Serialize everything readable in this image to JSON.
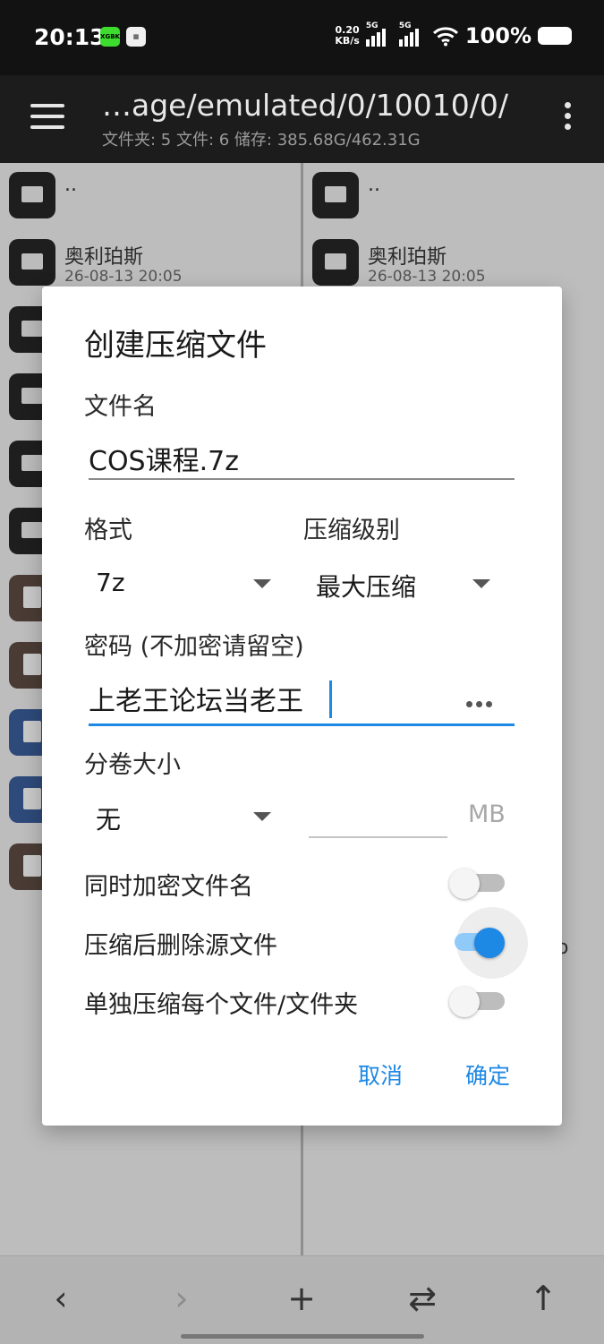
{
  "status_bar": {
    "time": "20:13",
    "net_speed_value": "0.20",
    "net_speed_unit": "KB/s",
    "sim1_label": "5G",
    "sim2_label": "5G",
    "battery_pct": "100%",
    "badge1": "XGBK",
    "badge1_color": "#3ddc2e"
  },
  "app_bar": {
    "path": "…age/emulated/0/10010/0/",
    "summary": "文件夹: 5   文件: 6   储存: 385.68G/462.31G"
  },
  "panes": {
    "left": [
      {
        "name": "..",
        "date": "",
        "kind": "folder"
      },
      {
        "name": "奥利珀斯",
        "date": "26-08-13 20:05",
        "kind": "folder"
      },
      {
        "name": "",
        "date": "",
        "kind": "folder"
      },
      {
        "name": "",
        "date": "",
        "kind": "folder"
      },
      {
        "name": "",
        "date": "",
        "kind": "folder"
      },
      {
        "name": "",
        "date": "",
        "kind": "folder"
      },
      {
        "name": "",
        "date": "",
        "kind": "archive"
      },
      {
        "name": "",
        "date": "",
        "kind": "archive"
      },
      {
        "name": "",
        "date": "",
        "kind": "doc"
      },
      {
        "name": "",
        "date": "",
        "kind": "doc"
      },
      {
        "name": "",
        "date": "",
        "kind": "archive"
      }
    ],
    "right": [
      {
        "name": "..",
        "date": "",
        "kind": "folder"
      },
      {
        "name": "奥利珀斯",
        "date": "26-08-13 20:05",
        "kind": "folder"
      }
    ],
    "right_stray_text": "o"
  },
  "dialog": {
    "title": "创建压缩文件",
    "filename_label": "文件名",
    "filename_value": "COS课程.7z",
    "format_label": "格式",
    "format_value": "7z",
    "level_label": "压缩级别",
    "level_value": "最大压缩",
    "password_label": "密码 (不加密请留空)",
    "password_value": "上老王论坛当老王",
    "volume_label": "分卷大小",
    "volume_value": "无",
    "volume_unit": "MB",
    "switches": [
      {
        "label": "同时加密文件名",
        "on": false
      },
      {
        "label": "压缩后删除源文件",
        "on": true
      },
      {
        "label": "单独压缩每个文件/文件夹",
        "on": false
      }
    ],
    "cancel": "取消",
    "ok": "确定",
    "accent_color": "#1e88e5"
  },
  "bottom_bar": {
    "back": "‹",
    "forward": "›",
    "add": "+",
    "swap": "⇄",
    "up": "↑"
  }
}
